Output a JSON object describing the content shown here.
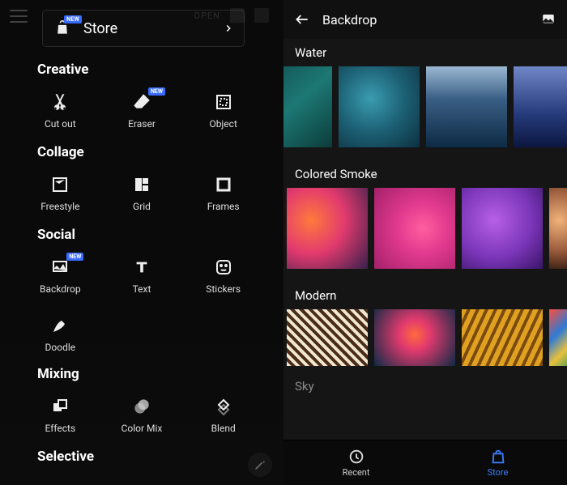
{
  "store": {
    "label": "Store",
    "new_badge": "NEW"
  },
  "sections": {
    "creative": {
      "title": "Creative",
      "tools": [
        {
          "label": "Cut out",
          "icon": "scissors"
        },
        {
          "label": "Eraser",
          "icon": "eraser",
          "new": "NEW"
        },
        {
          "label": "Object",
          "icon": "object"
        }
      ]
    },
    "collage": {
      "title": "Collage",
      "tools": [
        {
          "label": "Freestyle",
          "icon": "freestyle"
        },
        {
          "label": "Grid",
          "icon": "grid"
        },
        {
          "label": "Frames",
          "icon": "frame"
        }
      ]
    },
    "social": {
      "title": "Social",
      "tools": [
        {
          "label": "Backdrop",
          "icon": "backdrop",
          "new": "NEW"
        },
        {
          "label": "Text",
          "icon": "text"
        },
        {
          "label": "Stickers",
          "icon": "stickers"
        }
      ],
      "extra": [
        {
          "label": "Doodle",
          "icon": "doodle"
        }
      ]
    },
    "mixing": {
      "title": "Mixing",
      "tools": [
        {
          "label": "Effects",
          "icon": "effects"
        },
        {
          "label": "Color Mix",
          "icon": "colormix"
        },
        {
          "label": "Blend",
          "icon": "blend"
        }
      ]
    },
    "selective": {
      "title": "Selective"
    }
  },
  "right": {
    "header": "Backdrop",
    "categories": [
      {
        "title": "Water"
      },
      {
        "title": "Colored Smoke"
      },
      {
        "title": "Modern"
      },
      {
        "title": "Sky"
      }
    ],
    "nav": {
      "recent": "Recent",
      "store": "Store"
    }
  }
}
